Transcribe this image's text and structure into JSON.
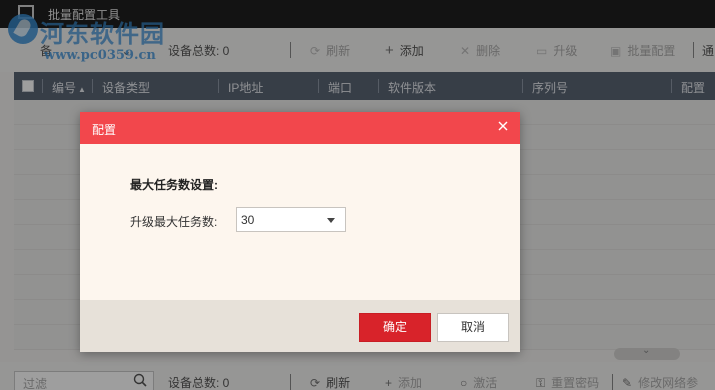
{
  "window": {
    "title": "批量配置工具"
  },
  "watermark": {
    "text": "河东软件园",
    "url": "www.pc0359.cn"
  },
  "toolbar": {
    "dropdown_partial": "备",
    "device_count": "设备总数: 0",
    "refresh": "刷新",
    "add": "添加",
    "delete": "删除",
    "upgrade": "升级",
    "batch_config": "批量配置",
    "more_partial": "通"
  },
  "table": {
    "columns": [
      "编号",
      "设备类型",
      "IP地址",
      "端口",
      "软件版本",
      "序列号",
      "配置"
    ]
  },
  "bottombar": {
    "filter_placeholder": "过滤",
    "device_count": "设备总数: 0",
    "refresh": "刷新",
    "add": "添加",
    "activate": "激活",
    "reset_password": "重置密码",
    "modify_network": "修改网络参"
  },
  "dialog": {
    "title": "配置",
    "section_title": "最大任务数设置:",
    "field_label": "升级最大任务数:",
    "field_value": "30",
    "ok_label": "确定",
    "cancel_label": "取消"
  },
  "colors": {
    "dialog_header": "#f2474c",
    "ok_button": "#d8232a",
    "table_header": "#5a6473",
    "titlebar": "#1f1f1f"
  }
}
